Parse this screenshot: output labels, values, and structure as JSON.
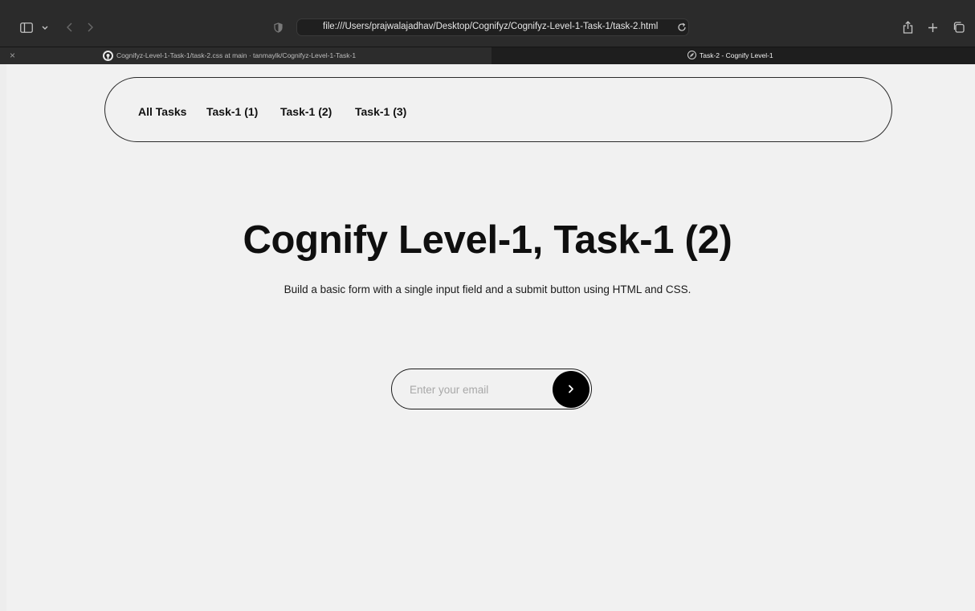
{
  "browser": {
    "url": "file:///Users/prajwalajadhav/Desktop/Cognifyz/Cognifyz-Level-1-Task-1/task-2.html",
    "tabs": [
      {
        "title": "Cognifyz-Level-1-Task-1/task-2.css at main · tanmaylk/Cognifyz-Level-1-Task-1",
        "icon": "github-icon",
        "active": false
      },
      {
        "title": "Task-2 - Cognify Level-1",
        "icon": "compass-icon",
        "active": true
      }
    ],
    "tab_close_label": "×"
  },
  "nav": {
    "links": [
      "All Tasks",
      "Task-1 (1)",
      "Task-1 (2)",
      "Task-1 (3)"
    ]
  },
  "hero": {
    "title": "Cognify Level-1, Task-1 (2)",
    "subtitle": "Build a basic form with a single input field and a submit button using HTML and CSS."
  },
  "form": {
    "placeholder": "Enter your email",
    "value": "",
    "submit_icon": "chevron-right-icon"
  },
  "colors": {
    "page_bg": "#f1f1f1",
    "text": "#0f0f0f",
    "submit_bg": "#000000",
    "chrome_bg": "#2b2b2b"
  }
}
